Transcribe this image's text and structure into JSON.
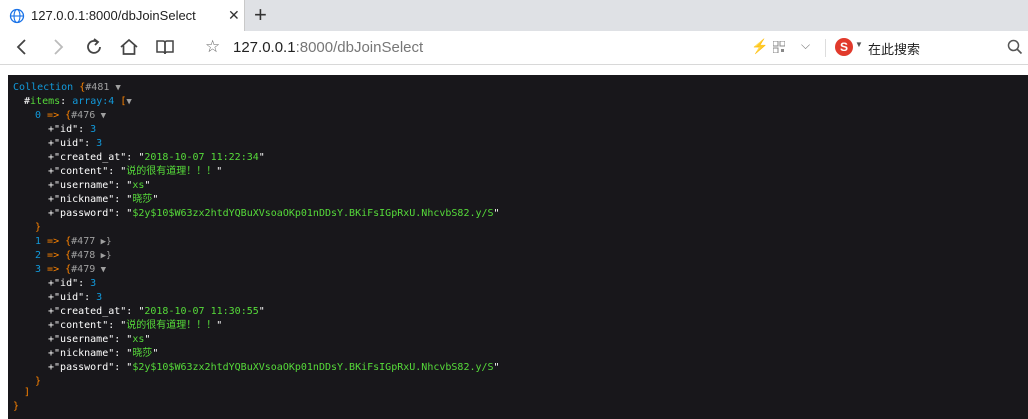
{
  "tab": {
    "title": "127.0.0.1:8000/dbJoinSelect",
    "close": "✕",
    "new_tab": "+"
  },
  "address": {
    "host": "127.0.0.1",
    "path": ":8000/dbJoinSelect"
  },
  "search": {
    "placeholder": "在此搜索"
  },
  "dump": {
    "line1": {
      "cls": "Collection",
      "brace": "{",
      "id": "#481",
      "tri": "▼"
    },
    "line2": {
      "mod": "#",
      "key": "items",
      "colon": ": ",
      "type": "array:4",
      "bracket": " [",
      "tri": "▼"
    },
    "rows": [
      {
        "idx": "0",
        "arrow": " => ",
        "brace": "{",
        "id": "#476",
        "tri": " ▼",
        "fields": [
          {
            "key": "id",
            "value": "3",
            "num": true
          },
          {
            "key": "uid",
            "value": "3",
            "num": true
          },
          {
            "key": "created_at",
            "value": "2018-10-07 11:22:34"
          },
          {
            "key": "content",
            "value": "说的很有道理！！！"
          },
          {
            "key": "username",
            "value": "xs"
          },
          {
            "key": "nickname",
            "value": "晓莎"
          },
          {
            "key": "password",
            "value": "$2y$10$W63zx2htdYQBuXVsoaOKp01nDDsY.BKiFsIGpRxU.NhcvbS82.y/S"
          }
        ],
        "close": "}"
      },
      {
        "idx": "1",
        "arrow": " => ",
        "brace": "{",
        "id": "#477",
        "tri": " ▶}"
      },
      {
        "idx": "2",
        "arrow": " => ",
        "brace": "{",
        "id": "#478",
        "tri": " ▶}"
      },
      {
        "idx": "3",
        "arrow": " => ",
        "brace": "{",
        "id": "#479",
        "tri": " ▼",
        "fields": [
          {
            "key": "id",
            "value": "3",
            "num": true
          },
          {
            "key": "uid",
            "value": "3",
            "num": true
          },
          {
            "key": "created_at",
            "value": "2018-10-07 11:30:55"
          },
          {
            "key": "content",
            "value": "说的很有道理！！！"
          },
          {
            "key": "username",
            "value": "xs"
          },
          {
            "key": "nickname",
            "value": "晓莎"
          },
          {
            "key": "password",
            "value": "$2y$10$W63zx2htdYQBuXVsoaOKp01nDDsY.BKiFsIGpRxU.NhcvbS82.y/S"
          }
        ],
        "close": "}"
      }
    ],
    "close_bracket": "]",
    "close_brace": "}"
  }
}
